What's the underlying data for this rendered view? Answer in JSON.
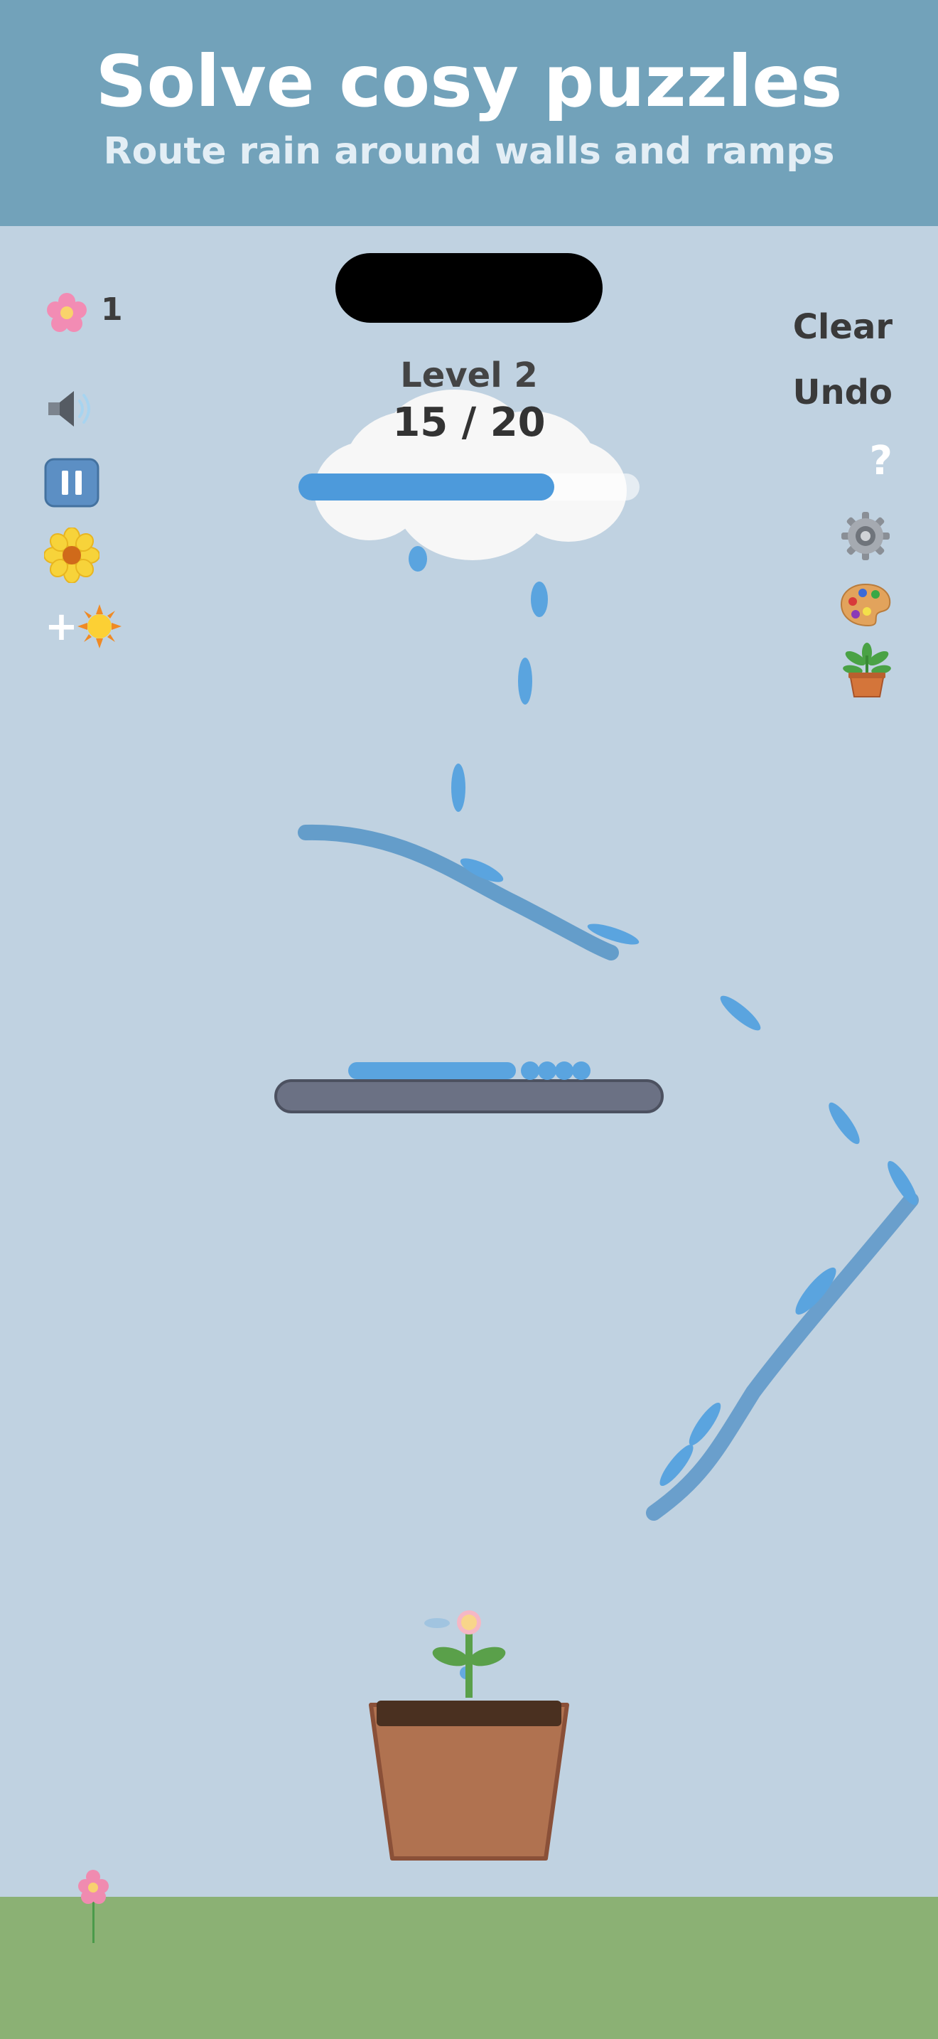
{
  "banner": {
    "title": "Solve cosy puzzles",
    "subtitle": "Route rain around walls and ramps"
  },
  "hud": {
    "flowers_icon": "pink-flower-icon",
    "flowers_count": "1",
    "level_label": "Level 2",
    "progress_text": "15 / 20",
    "progress_fraction": 0.75,
    "clear_label": "Clear",
    "undo_label": "Undo",
    "help_label": "?",
    "left_buttons": [
      "speaker-icon",
      "pause-icon",
      "yellow-flower-icon",
      "add-sun-icon"
    ],
    "right_buttons": [
      "gear-icon",
      "palette-icon",
      "potted-plant-icon"
    ],
    "add_sun_symbol": "+"
  },
  "colors": {
    "sky": "#c0d2e1",
    "banner": "#72a2ba",
    "water": "#5aa4df",
    "ramp": "#5a97c8",
    "wall": "#6b7184",
    "pot": "#b07250",
    "soil": "#4a3020",
    "ground": "#8bb174"
  }
}
